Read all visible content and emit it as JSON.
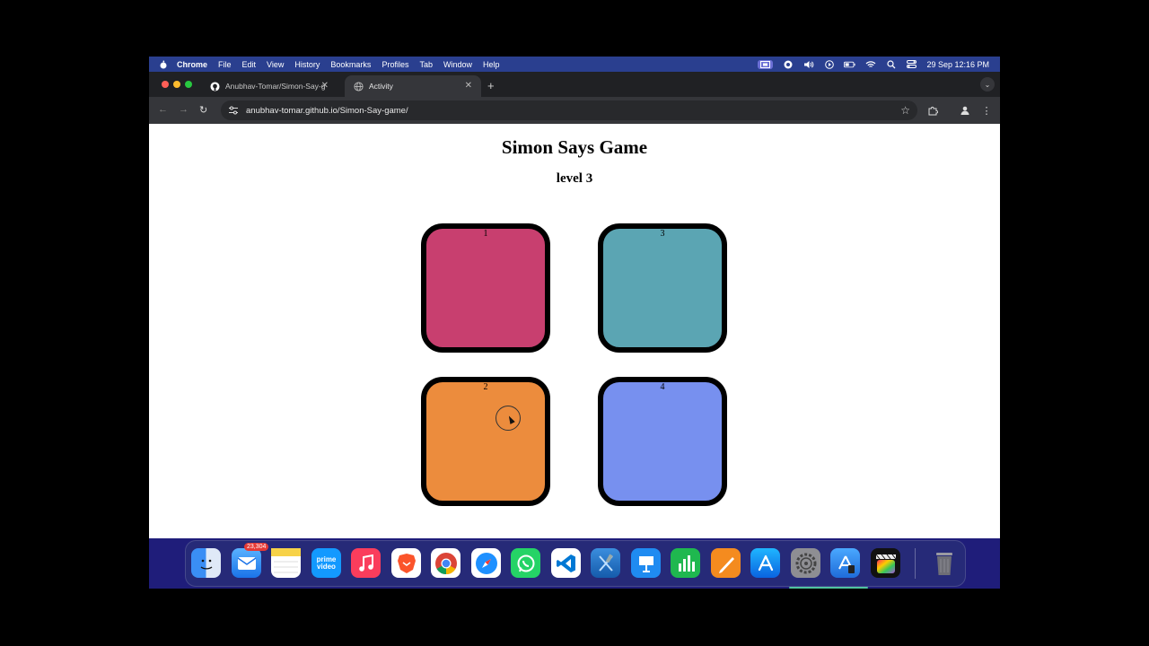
{
  "menubar": {
    "app": "Chrome",
    "items": [
      "File",
      "Edit",
      "View",
      "History",
      "Bookmarks",
      "Profiles",
      "Tab",
      "Window",
      "Help"
    ],
    "clock": "29 Sep  12:16 PM"
  },
  "tabs": [
    {
      "title": "Anubhav-Tomar/Simon-Say-g",
      "icon": "github-icon"
    },
    {
      "title": "Activity",
      "icon": "globe-icon"
    }
  ],
  "omnibox": {
    "url": "anubhav-tomar.github.io/Simon-Say-game/"
  },
  "page": {
    "title": "Simon Says Game",
    "level": "level 3",
    "buttons": [
      {
        "label": "1",
        "color": "#c83f6f"
      },
      {
        "label": "3",
        "color": "#5ba5b3"
      },
      {
        "label": "2",
        "color": "#ec8c3d"
      },
      {
        "label": "4",
        "color": "#7790ef"
      }
    ]
  },
  "dock": {
    "mail_badge": "23,304",
    "prime_label": "prime video",
    "apps": [
      "finder",
      "mail",
      "notes",
      "prime-video",
      "music",
      "brave",
      "chrome",
      "safari",
      "whatsapp",
      "vscode",
      "xcode",
      "keynote",
      "numbers",
      "pages",
      "app-store",
      "system-settings",
      "simulator",
      "final-cut-pro",
      "trash"
    ]
  },
  "colors": {
    "menubar": "#2a3f8f",
    "page_bg": "#ffffff",
    "chrome_dark": "#202124"
  }
}
